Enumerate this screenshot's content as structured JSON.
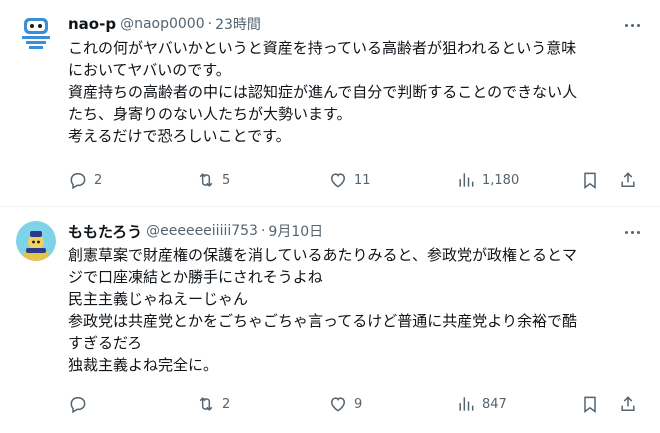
{
  "posts": [
    {
      "name": "nao-p",
      "handle": "@naop0000",
      "time": "23時間",
      "lines": [
        "これの何がヤバいかというと資産を持っている高齢者が狙われるという意味",
        "においてヤバいのです。",
        "資産持ちの高齢者の中には認知症が進んで自分で判断することのできない人",
        "たち、身寄りのない人たちが大勢います。",
        "考えるだけで恐ろしいことです。"
      ],
      "replies": "2",
      "reposts": "5",
      "likes": "11",
      "views": "1,180"
    },
    {
      "name": "ももたろう",
      "handle": "@eeeeeeiiiii753",
      "time": "9月10日",
      "lines": [
        "創憲草案で財産権の保護を消しているあたりみると、参政党が政権とるとマ",
        "ジで口座凍結とか勝手にされそうよね",
        "民主主義じゃねえーじゃん",
        "参政党は共産党とかをごちゃごちゃ言ってるけど普通に共産党より余裕で酷",
        "すぎるだろ",
        "独裁主義よね完全に。"
      ],
      "replies": "",
      "reposts": "2",
      "likes": "9",
      "views": "847"
    }
  ],
  "sep": "·",
  "icons": {
    "reply": "reply-bubble-icon",
    "repost": "repost-arrows-icon",
    "like": "heart-icon",
    "views": "bar-chart-icon",
    "bookmark": "bookmark-icon",
    "share": "share-upload-icon"
  },
  "colors": {
    "text": "#0f1419",
    "secondary": "#536471",
    "divider": "#eff3f4"
  }
}
